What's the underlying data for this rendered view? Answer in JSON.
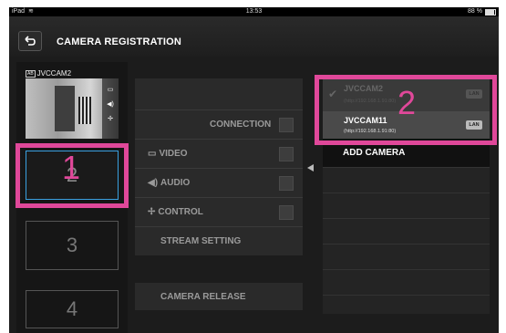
{
  "status_bar": {
    "device": "iPad",
    "time": "13:53",
    "battery": "88 %",
    "battery_level": 0.88
  },
  "header": {
    "title": "CAMERA REGISTRATION"
  },
  "left": {
    "preview_camera_name": "JVCCAM2",
    "slots": [
      {
        "number": "2"
      },
      {
        "number": "3"
      },
      {
        "number": "4"
      }
    ]
  },
  "middle": {
    "connection": "CONNECTION",
    "video": "VIDEO",
    "audio": "AUDIO",
    "control": "CONTROL",
    "stream_setting": "STREAM SETTING",
    "camera_release": "CAMERA RELEASE"
  },
  "camera_list": {
    "items": [
      {
        "name": "JVCCAM2",
        "address": "(http://192.168.1.91:80)",
        "connection": "LAN",
        "checked": true
      },
      {
        "name": "JVCCAM11",
        "address": "(http://192.168.1.91:80)",
        "connection": "LAN",
        "checked": false
      }
    ],
    "add_camera": "ADD CAMERA"
  },
  "annotations": [
    {
      "number": "1"
    },
    {
      "number": "2"
    }
  ],
  "colors": {
    "highlight": "#e0489a",
    "selected_border": "#3aa0e0"
  }
}
